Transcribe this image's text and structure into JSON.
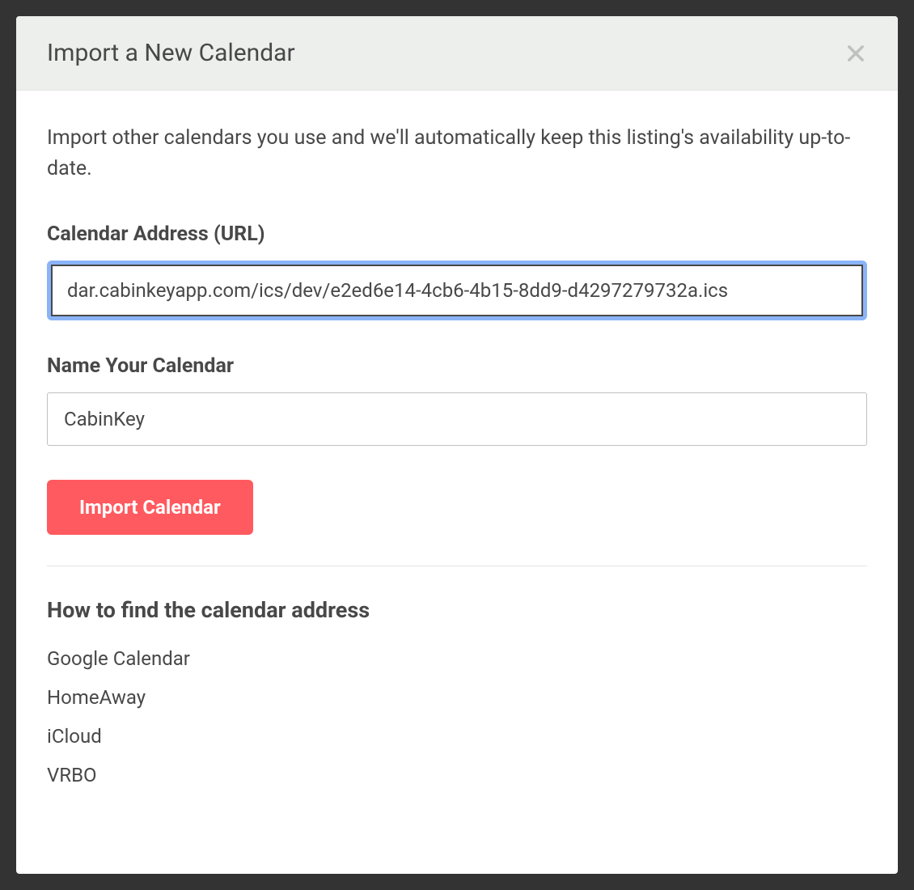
{
  "modal": {
    "title": "Import a New Calendar",
    "description": "Import other calendars you use and we'll automatically keep this listing's availability up-to-date."
  },
  "form": {
    "url_label": "Calendar Address (URL)",
    "url_value": "dar.cabinkeyapp.com/ics/dev/e2ed6e14-4cb6-4b15-8dd9-d4297279732a.ics",
    "name_label": "Name Your Calendar",
    "name_value": "CabinKey",
    "submit_label": "Import Calendar"
  },
  "help": {
    "heading": "How to find the calendar address",
    "links": [
      "Google Calendar",
      "HomeAway",
      "iCloud",
      "VRBO"
    ]
  }
}
